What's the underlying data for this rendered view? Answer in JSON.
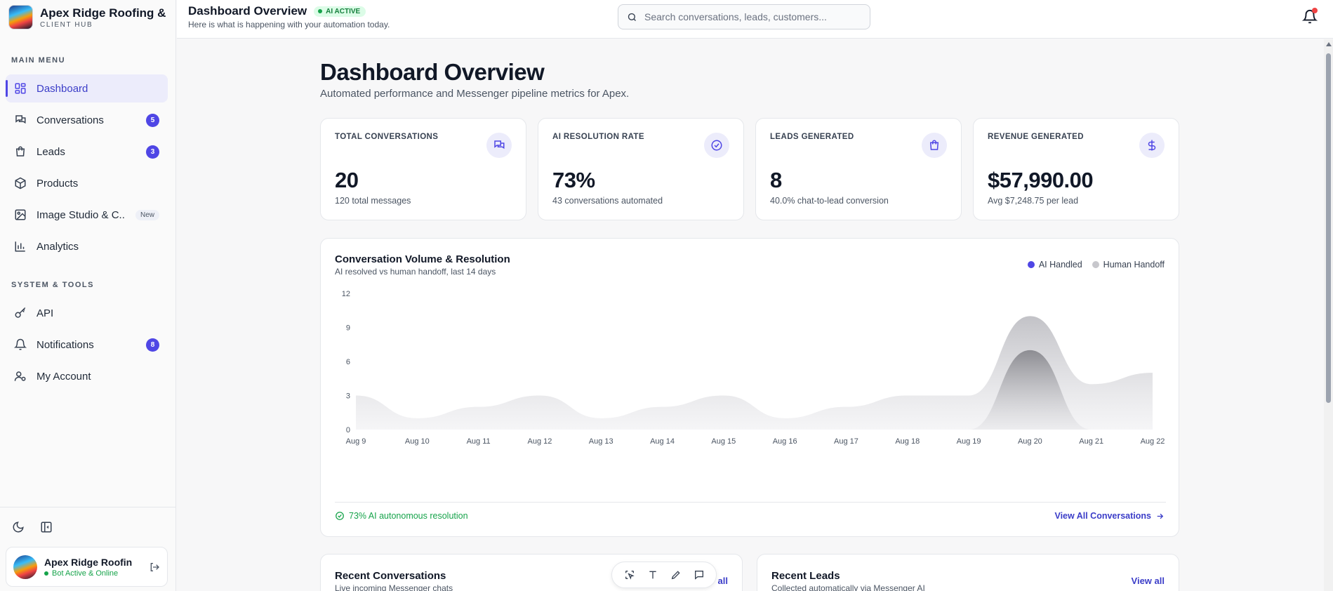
{
  "brand": {
    "name": "Apex Ridge Roofing & ...",
    "subtitle": "CLIENT HUB"
  },
  "sidebar": {
    "main_menu_label": "MAIN MENU",
    "main_items": [
      {
        "label": "Dashboard",
        "icon": "grid-icon",
        "active": true
      },
      {
        "label": "Conversations",
        "icon": "chat-icon",
        "badge": "5"
      },
      {
        "label": "Leads",
        "icon": "shopping-bag-icon",
        "badge": "3"
      },
      {
        "label": "Products",
        "icon": "box-icon"
      },
      {
        "label": "Image Studio & C...",
        "icon": "image-icon",
        "tag": "New"
      },
      {
        "label": "Analytics",
        "icon": "bar-chart-icon"
      }
    ],
    "tools_label": "SYSTEM & TOOLS",
    "tool_items": [
      {
        "label": "API",
        "icon": "key-icon"
      },
      {
        "label": "Notifications",
        "icon": "bell-icon",
        "badge": "8"
      },
      {
        "label": "My Account",
        "icon": "user-gear-icon"
      }
    ],
    "account": {
      "name": "Apex Ridge Roofin...",
      "status": "Bot Active & Online"
    }
  },
  "topbar": {
    "title": "Dashboard Overview",
    "badge": "AI ACTIVE",
    "subtitle": "Here is what is happening with your automation today.",
    "search_placeholder": "Search conversations, leads, customers..."
  },
  "main": {
    "title": "Dashboard Overview",
    "subtitle": "Automated performance and Messenger pipeline metrics for Apex.",
    "stats": [
      {
        "label": "TOTAL CONVERSATIONS",
        "value": "20",
        "sub": "120 total messages",
        "icon": "chat-icon"
      },
      {
        "label": "AI RESOLUTION RATE",
        "value": "73%",
        "sub": "43 conversations automated",
        "icon": "check-circle-icon"
      },
      {
        "label": "LEADS GENERATED",
        "value": "8",
        "sub": "40.0% chat-to-lead conversion",
        "icon": "shopping-bag-icon"
      },
      {
        "label": "REVENUE GENERATED",
        "value": "$57,990.00",
        "sub": "Avg $7,248.75 per lead",
        "icon": "dollar-icon"
      }
    ],
    "chart_footer": {
      "left": "73% AI autonomous resolution",
      "right": "View All Conversations"
    },
    "recent_conversations": {
      "title": "Recent Conversations",
      "subtitle": "Live incoming Messenger chats",
      "link": "all"
    },
    "recent_leads": {
      "title": "Recent Leads",
      "subtitle": "Collected automatically via Messenger AI",
      "link": "View all"
    }
  },
  "chart_data": {
    "type": "area",
    "title": "Conversation Volume & Resolution",
    "subtitle": "AI resolved vs human handoff, last 14 days",
    "legend_position": "top-right",
    "categories": [
      "Aug 9",
      "Aug 10",
      "Aug 11",
      "Aug 12",
      "Aug 13",
      "Aug 14",
      "Aug 15",
      "Aug 16",
      "Aug 17",
      "Aug 18",
      "Aug 19",
      "Aug 20",
      "Aug 21",
      "Aug 22"
    ],
    "yticks": [
      "0",
      "3",
      "6",
      "9",
      "12"
    ],
    "ylim": [
      0,
      12
    ],
    "series": [
      {
        "name": "AI Handled",
        "color": "#4f46e5",
        "values": [
          0,
          0,
          0,
          0,
          0,
          0,
          0,
          0,
          0,
          0,
          0,
          7,
          0,
          0
        ]
      },
      {
        "name": "Human Handoff",
        "color": "#c7c7cc",
        "values": [
          3,
          1,
          2,
          3,
          1,
          2,
          3,
          1,
          2,
          3,
          3,
          10,
          4,
          5
        ]
      }
    ]
  }
}
